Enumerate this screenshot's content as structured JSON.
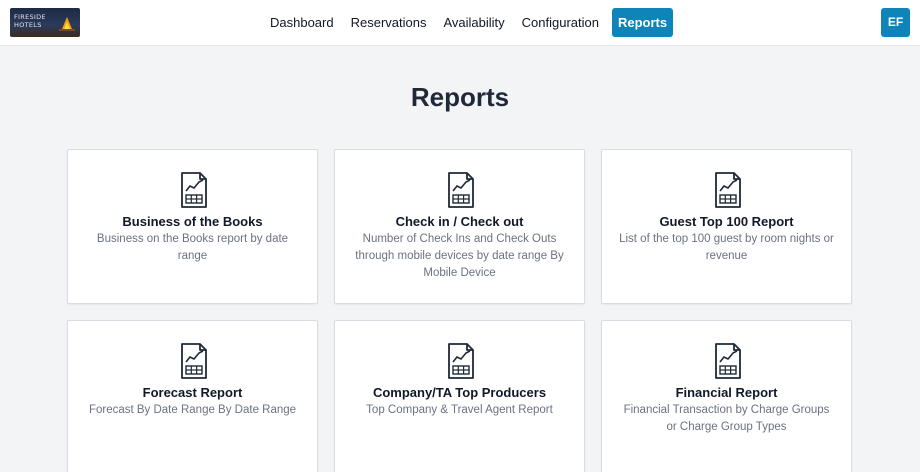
{
  "brand": {
    "logo_line1": "FIRESIDE",
    "logo_line2": "HOTELS"
  },
  "nav": {
    "items": [
      {
        "label": "Dashboard"
      },
      {
        "label": "Reservations"
      },
      {
        "label": "Availability"
      },
      {
        "label": "Configuration"
      },
      {
        "label": "Reports",
        "active": true
      }
    ]
  },
  "user": {
    "initials": "EF"
  },
  "page": {
    "title": "Reports"
  },
  "reports": [
    {
      "title": "Business of the Books",
      "description": "Business on the Books report by date range"
    },
    {
      "title": "Check in / Check out",
      "description": "Number of Check Ins and Check Outs through mobile devices by date range By Mobile Device"
    },
    {
      "title": "Guest Top 100 Report",
      "description": "List of the top 100 guest by room nights or revenue"
    },
    {
      "title": "Forecast Report",
      "description": "Forecast By Date Range By Date Range"
    },
    {
      "title": "Company/TA Top Producers",
      "description": "Top Company & Travel Agent Report"
    },
    {
      "title": "Financial Report",
      "description": "Financial Transaction by Charge Groups or Charge Group Types"
    }
  ],
  "colors": {
    "accent": "#0f84b8",
    "background": "#f3f4f6",
    "card": "#ffffff"
  },
  "icons": {
    "report": "report-chart-icon"
  }
}
